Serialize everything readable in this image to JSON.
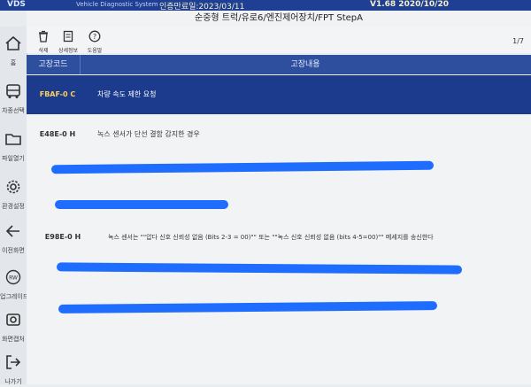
{
  "topbar": {
    "brand": "VDS",
    "system": "Vehicle Diagnostic System",
    "date": "인증만료일:2023/03/11",
    "version": "V1.68 2020/10/20"
  },
  "breadcrumb": "순중형 트럭/유로6/엔진제어장치/FPT StepA",
  "sidebar": {
    "items": [
      {
        "label": "홈"
      },
      {
        "label": "차종선택"
      },
      {
        "label": "파일열기"
      },
      {
        "label": "환경설정"
      },
      {
        "label": "이전화면"
      },
      {
        "label": "업그레이드",
        "badge": "RW"
      },
      {
        "label": "화면캡처"
      },
      {
        "label": "나가기"
      }
    ]
  },
  "toolbar": {
    "delete_label": "삭제",
    "detail_label": "상세정보",
    "help_label": "도움말",
    "page_indicator": "1/7"
  },
  "table": {
    "headers": {
      "code": "고장코드",
      "content": "고장내용"
    },
    "rows": [
      {
        "code": "FBAF-0 C",
        "desc": "차량 속도 제한 요청",
        "selected": true
      },
      {
        "code": "E48E-0 H",
        "desc": "녹스 센서가 단선 결함 감지한 경우",
        "selected": false
      },
      {
        "code": "E98E-0 H",
        "desc": "녹스 센서는 \"\"압다 신호 신뢰성 없음 (Bits 2-3 = 00)\"\" 또는 \"\"녹스 신호 신뢰성 없음 (bits 4-5=00)\"\" 메세지를 송신한다",
        "selected": false
      }
    ]
  },
  "colors": {
    "header_blue": "#2d4f9e",
    "selected_row": "#1c3b8c",
    "redaction": "#1f6dff"
  }
}
